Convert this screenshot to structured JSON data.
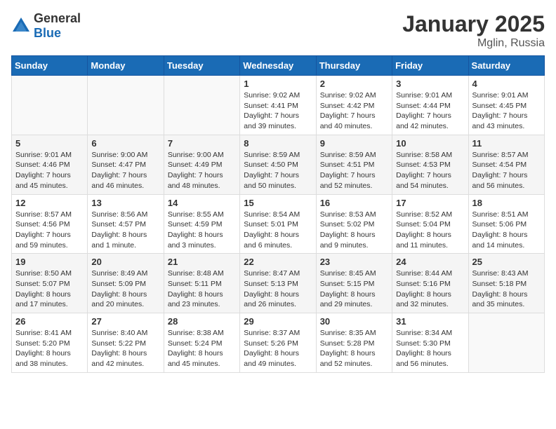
{
  "header": {
    "logo_general": "General",
    "logo_blue": "Blue",
    "title": "January 2025",
    "location": "Mglin, Russia"
  },
  "days_of_week": [
    "Sunday",
    "Monday",
    "Tuesday",
    "Wednesday",
    "Thursday",
    "Friday",
    "Saturday"
  ],
  "weeks": [
    [
      {
        "day": "",
        "info": ""
      },
      {
        "day": "",
        "info": ""
      },
      {
        "day": "",
        "info": ""
      },
      {
        "day": "1",
        "info": "Sunrise: 9:02 AM\nSunset: 4:41 PM\nDaylight: 7 hours\nand 39 minutes."
      },
      {
        "day": "2",
        "info": "Sunrise: 9:02 AM\nSunset: 4:42 PM\nDaylight: 7 hours\nand 40 minutes."
      },
      {
        "day": "3",
        "info": "Sunrise: 9:01 AM\nSunset: 4:44 PM\nDaylight: 7 hours\nand 42 minutes."
      },
      {
        "day": "4",
        "info": "Sunrise: 9:01 AM\nSunset: 4:45 PM\nDaylight: 7 hours\nand 43 minutes."
      }
    ],
    [
      {
        "day": "5",
        "info": "Sunrise: 9:01 AM\nSunset: 4:46 PM\nDaylight: 7 hours\nand 45 minutes."
      },
      {
        "day": "6",
        "info": "Sunrise: 9:00 AM\nSunset: 4:47 PM\nDaylight: 7 hours\nand 46 minutes."
      },
      {
        "day": "7",
        "info": "Sunrise: 9:00 AM\nSunset: 4:49 PM\nDaylight: 7 hours\nand 48 minutes."
      },
      {
        "day": "8",
        "info": "Sunrise: 8:59 AM\nSunset: 4:50 PM\nDaylight: 7 hours\nand 50 minutes."
      },
      {
        "day": "9",
        "info": "Sunrise: 8:59 AM\nSunset: 4:51 PM\nDaylight: 7 hours\nand 52 minutes."
      },
      {
        "day": "10",
        "info": "Sunrise: 8:58 AM\nSunset: 4:53 PM\nDaylight: 7 hours\nand 54 minutes."
      },
      {
        "day": "11",
        "info": "Sunrise: 8:57 AM\nSunset: 4:54 PM\nDaylight: 7 hours\nand 56 minutes."
      }
    ],
    [
      {
        "day": "12",
        "info": "Sunrise: 8:57 AM\nSunset: 4:56 PM\nDaylight: 7 hours\nand 59 minutes."
      },
      {
        "day": "13",
        "info": "Sunrise: 8:56 AM\nSunset: 4:57 PM\nDaylight: 8 hours\nand 1 minute."
      },
      {
        "day": "14",
        "info": "Sunrise: 8:55 AM\nSunset: 4:59 PM\nDaylight: 8 hours\nand 3 minutes."
      },
      {
        "day": "15",
        "info": "Sunrise: 8:54 AM\nSunset: 5:01 PM\nDaylight: 8 hours\nand 6 minutes."
      },
      {
        "day": "16",
        "info": "Sunrise: 8:53 AM\nSunset: 5:02 PM\nDaylight: 8 hours\nand 9 minutes."
      },
      {
        "day": "17",
        "info": "Sunrise: 8:52 AM\nSunset: 5:04 PM\nDaylight: 8 hours\nand 11 minutes."
      },
      {
        "day": "18",
        "info": "Sunrise: 8:51 AM\nSunset: 5:06 PM\nDaylight: 8 hours\nand 14 minutes."
      }
    ],
    [
      {
        "day": "19",
        "info": "Sunrise: 8:50 AM\nSunset: 5:07 PM\nDaylight: 8 hours\nand 17 minutes."
      },
      {
        "day": "20",
        "info": "Sunrise: 8:49 AM\nSunset: 5:09 PM\nDaylight: 8 hours\nand 20 minutes."
      },
      {
        "day": "21",
        "info": "Sunrise: 8:48 AM\nSunset: 5:11 PM\nDaylight: 8 hours\nand 23 minutes."
      },
      {
        "day": "22",
        "info": "Sunrise: 8:47 AM\nSunset: 5:13 PM\nDaylight: 8 hours\nand 26 minutes."
      },
      {
        "day": "23",
        "info": "Sunrise: 8:45 AM\nSunset: 5:15 PM\nDaylight: 8 hours\nand 29 minutes."
      },
      {
        "day": "24",
        "info": "Sunrise: 8:44 AM\nSunset: 5:16 PM\nDaylight: 8 hours\nand 32 minutes."
      },
      {
        "day": "25",
        "info": "Sunrise: 8:43 AM\nSunset: 5:18 PM\nDaylight: 8 hours\nand 35 minutes."
      }
    ],
    [
      {
        "day": "26",
        "info": "Sunrise: 8:41 AM\nSunset: 5:20 PM\nDaylight: 8 hours\nand 38 minutes."
      },
      {
        "day": "27",
        "info": "Sunrise: 8:40 AM\nSunset: 5:22 PM\nDaylight: 8 hours\nand 42 minutes."
      },
      {
        "day": "28",
        "info": "Sunrise: 8:38 AM\nSunset: 5:24 PM\nDaylight: 8 hours\nand 45 minutes."
      },
      {
        "day": "29",
        "info": "Sunrise: 8:37 AM\nSunset: 5:26 PM\nDaylight: 8 hours\nand 49 minutes."
      },
      {
        "day": "30",
        "info": "Sunrise: 8:35 AM\nSunset: 5:28 PM\nDaylight: 8 hours\nand 52 minutes."
      },
      {
        "day": "31",
        "info": "Sunrise: 8:34 AM\nSunset: 5:30 PM\nDaylight: 8 hours\nand 56 minutes."
      },
      {
        "day": "",
        "info": ""
      }
    ]
  ]
}
